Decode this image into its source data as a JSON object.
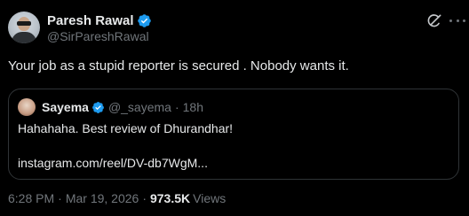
{
  "author": {
    "display_name": "Paresh Rawal",
    "handle": "@SirPareshRawal",
    "verified_color": "#1d9bf0"
  },
  "tweet": {
    "text": "Your job as a stupid reporter is secured . Nobody wants it.",
    "time": "6:28 PM",
    "date": "Mar 19, 2026",
    "separator": "·",
    "views_count": "973.5K",
    "views_label": "Views"
  },
  "quoted": {
    "display_name": "Sayema",
    "handle": "@_sayema",
    "dot": "·",
    "time_ago": "18h",
    "text": "Hahahaha. Best review of Dhurandhar!",
    "link": "instagram.com/reel/DV-db7WgM..."
  },
  "icons": {
    "grok": "grok-icon",
    "more": "more-icon",
    "verified": "verified-badge-icon"
  },
  "colors": {
    "background": "#000000",
    "text": "#e7e9ea",
    "secondary": "#71767b",
    "border": "#2f3336",
    "accent": "#1d9bf0"
  }
}
